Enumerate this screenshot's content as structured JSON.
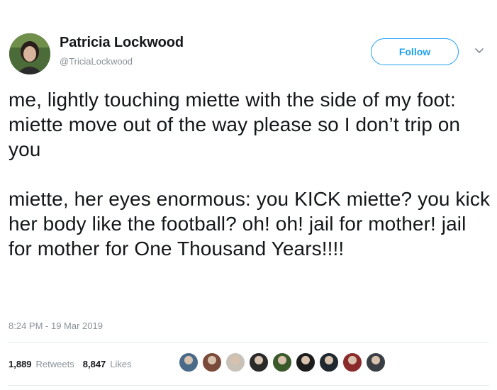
{
  "user": {
    "name": "Patricia Lockwood",
    "handle": "@TriciaLockwood"
  },
  "actions": {
    "follow_label": "Follow",
    "more_icon": "chevron-down-icon"
  },
  "tweet": {
    "paragraphs": [
      "me, lightly touching miette with the side of my foot: miette move out of the way please so I don’t trip on you",
      "miette, her eyes enormous: you KICK miette? you kick her body like the football? oh! oh! jail for mother! jail for mother for One Thousand Years!!!!"
    ],
    "timestamp": "8:24 PM - 19 Mar 2019"
  },
  "stats": {
    "retweets_count": "1,889",
    "retweets_label": "Retweets",
    "likes_count": "8,847",
    "likes_label": "Likes"
  },
  "likers": [
    {
      "color": "#4a6a8a"
    },
    {
      "color": "#7a4a3a"
    },
    {
      "color": "#c9c2b8"
    },
    {
      "color": "#2a2a2a"
    },
    {
      "color": "#3b5a2a"
    },
    {
      "color": "#1c1c1c"
    },
    {
      "color": "#202830"
    },
    {
      "color": "#8a2a2a"
    },
    {
      "color": "#3a3f45"
    }
  ],
  "colors": {
    "accent": "#1da1f2",
    "text": "#14171a",
    "muted": "#8a9199"
  }
}
